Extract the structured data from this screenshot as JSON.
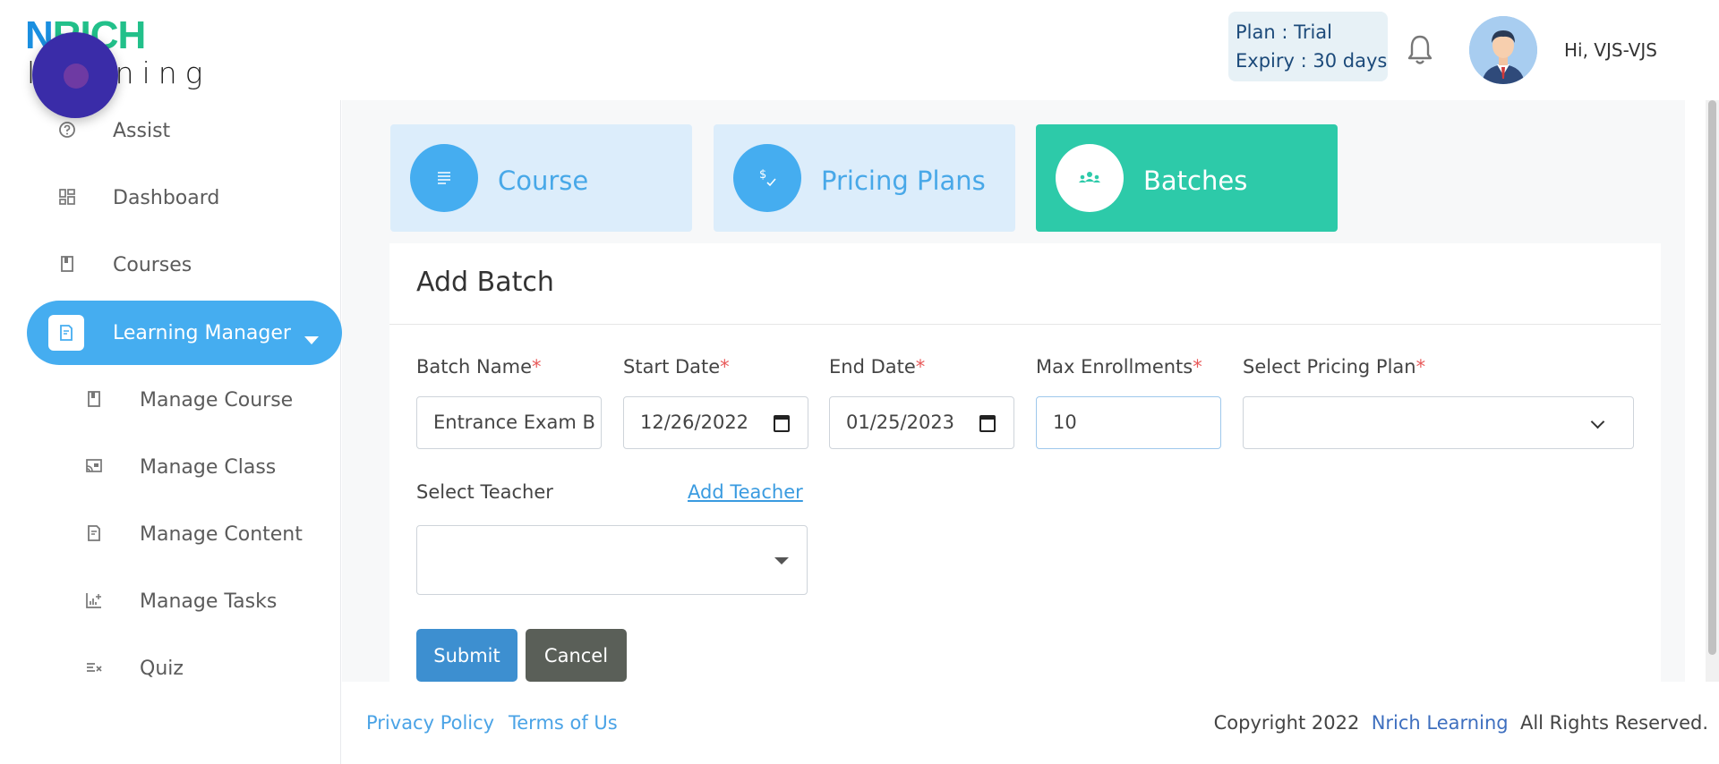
{
  "logo": {
    "line1_a": "N",
    "line1_b": "RICH",
    "line2": "learning"
  },
  "header": {
    "plan_line": "Plan   : Trial",
    "expiry_line": "Expiry : 30 days",
    "greeting": "Hi, VJS-VJS"
  },
  "sidebar": {
    "items": [
      {
        "label": "Assist",
        "icon": "help-circle-icon"
      },
      {
        "label": "Dashboard",
        "icon": "dashboard-grid-icon"
      },
      {
        "label": "Courses",
        "icon": "book-icon"
      },
      {
        "label": "Learning Manager",
        "icon": "document-icon",
        "active": true
      },
      {
        "label": "Manage Course",
        "icon": "book-icon"
      },
      {
        "label": "Manage Class",
        "icon": "cast-screen-icon"
      },
      {
        "label": "Manage Content",
        "icon": "document-icon"
      },
      {
        "label": "Manage Tasks",
        "icon": "chart-add-icon"
      },
      {
        "label": "Quiz",
        "icon": "list-check-icon"
      }
    ]
  },
  "tabs": [
    {
      "label": "Course",
      "icon": "list-lines-icon"
    },
    {
      "label": "Pricing Plans",
      "icon": "dollar-check-icon"
    },
    {
      "label": "Batches",
      "icon": "group-people-icon",
      "active": true
    }
  ],
  "form": {
    "title": "Add Batch",
    "batch_name": {
      "label": "Batch Name",
      "required": "*",
      "value": "Entrance Exam B"
    },
    "start_date": {
      "label": "Start Date",
      "required": "*",
      "value": "12/26/2022"
    },
    "end_date": {
      "label": "End Date",
      "required": "*",
      "value": "01/25/2023"
    },
    "max_enrollments": {
      "label": "Max Enrollments",
      "required": "*",
      "value": "10"
    },
    "pricing_plan": {
      "label": "Select Pricing Plan",
      "required": "*",
      "value": ""
    },
    "teacher": {
      "label": "Select Teacher",
      "value": ""
    },
    "add_teacher": "Add Teacher",
    "submit": "Submit",
    "cancel": "Cancel"
  },
  "footer": {
    "privacy": "Privacy Policy",
    "terms": "Terms of Us",
    "copyright_prefix": "Copyright 2022",
    "brand": "Nrich Learning",
    "copyright_suffix": "All Rights Reserved."
  },
  "colors": {
    "primary_blue": "#45adf0",
    "teal_active": "#2dcaa9",
    "light_blue_tab": "#dcedfb",
    "required_red": "#e85a5a"
  }
}
